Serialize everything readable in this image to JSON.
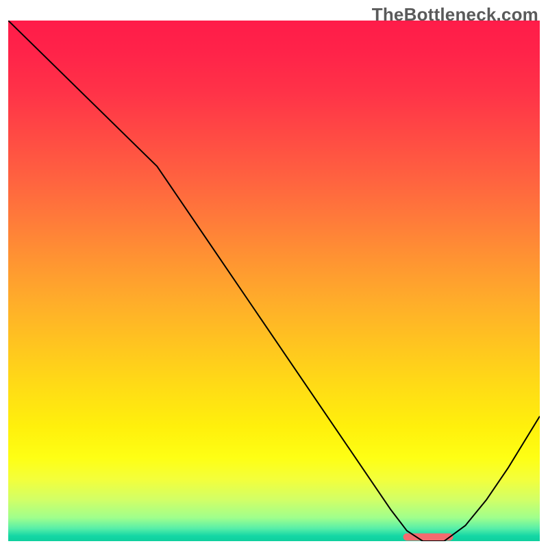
{
  "watermark": "TheBottleneck.com",
  "chart_data": {
    "type": "line",
    "title": "",
    "xlabel": "",
    "ylabel": "",
    "xlim": [
      0,
      100
    ],
    "ylim": [
      0,
      100
    ],
    "grid": false,
    "x": [
      0,
      6,
      12,
      18,
      24,
      28,
      34,
      40,
      46,
      52,
      58,
      64,
      68,
      72,
      75,
      78,
      82,
      86,
      90,
      94,
      100
    ],
    "values": [
      100,
      94,
      88,
      82,
      76,
      72,
      63,
      54,
      45,
      36,
      27,
      18,
      12,
      6,
      2,
      0,
      0,
      3,
      8,
      14,
      24
    ],
    "marker": {
      "x_start": 75,
      "x_end": 83,
      "y": 0
    },
    "background_gradient": {
      "stops": [
        {
          "offset": 0.0,
          "color": "#ff1c49"
        },
        {
          "offset": 0.06,
          "color": "#ff2349"
        },
        {
          "offset": 0.14,
          "color": "#ff3348"
        },
        {
          "offset": 0.22,
          "color": "#ff4a44"
        },
        {
          "offset": 0.3,
          "color": "#ff6140"
        },
        {
          "offset": 0.38,
          "color": "#ff7a3a"
        },
        {
          "offset": 0.46,
          "color": "#ff9432"
        },
        {
          "offset": 0.54,
          "color": "#ffad2a"
        },
        {
          "offset": 0.62,
          "color": "#ffc420"
        },
        {
          "offset": 0.7,
          "color": "#ffdb16"
        },
        {
          "offset": 0.78,
          "color": "#fff00c"
        },
        {
          "offset": 0.84,
          "color": "#feff14"
        },
        {
          "offset": 0.88,
          "color": "#f4ff3a"
        },
        {
          "offset": 0.92,
          "color": "#d2ff66"
        },
        {
          "offset": 0.955,
          "color": "#a0ff8c"
        },
        {
          "offset": 0.975,
          "color": "#5aefa8"
        },
        {
          "offset": 0.99,
          "color": "#14d7a5"
        },
        {
          "offset": 1.0,
          "color": "#0fcf9e"
        }
      ]
    }
  }
}
